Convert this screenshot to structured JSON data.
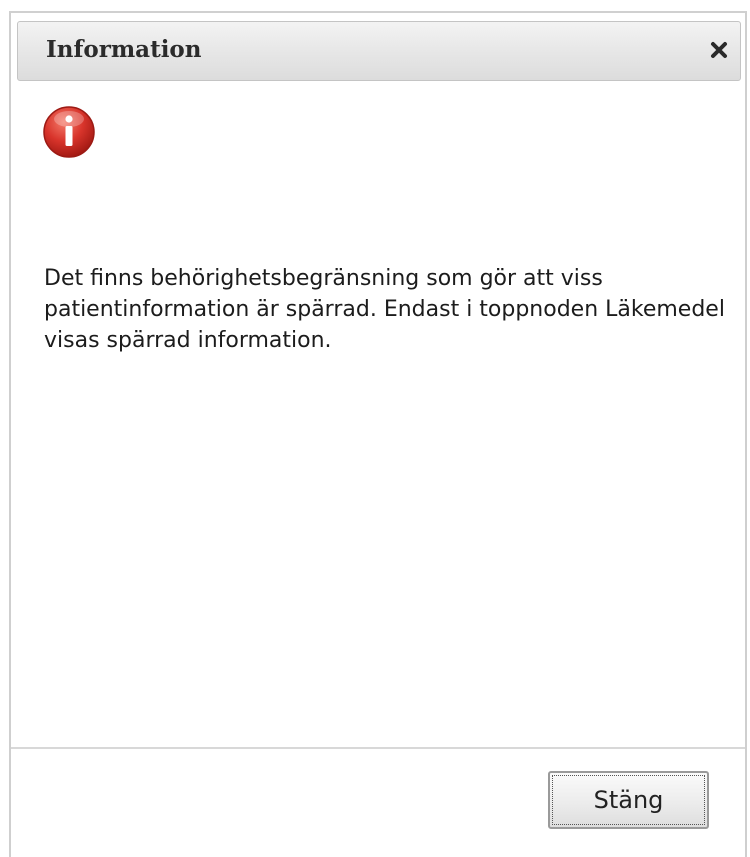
{
  "dialog": {
    "title": "Information",
    "close_icon": "close-icon",
    "status_icon": "info-icon",
    "message": "Det finns behörighetsbegränsning som gör att viss patientinformation är spärrad. Endast i toppnoden Läkemedel visas spärrad information.",
    "close_button_label": "Stäng"
  },
  "colors": {
    "icon_red": "#d8342b",
    "title_bar": "#e6e6e6",
    "text": "#1c1c1c"
  }
}
